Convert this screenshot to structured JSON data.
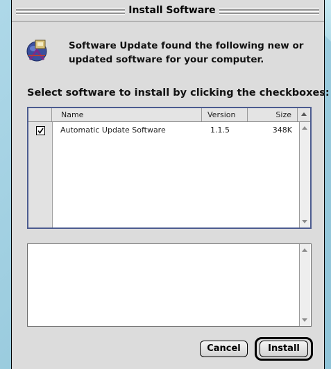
{
  "window": {
    "title": "Install Software"
  },
  "message": {
    "line1": "Software Update found the following new or",
    "line2": "updated software for your computer."
  },
  "instruction": "Select software to install by clicking the checkboxes:",
  "table": {
    "columns": {
      "name": "Name",
      "version": "Version",
      "size": "Size"
    },
    "rows": [
      {
        "checked": true,
        "name": "Automatic Update Software",
        "version": "1.1.5",
        "size": "348K"
      }
    ]
  },
  "buttons": {
    "cancel": "Cancel",
    "install": "Install"
  },
  "icons": {
    "app": "software-update-icon",
    "checkbox": "checkmark-icon",
    "scroll_up": "up-arrow-icon",
    "scroll_down": "down-arrow-icon",
    "sort": "sort-triangle-icon"
  },
  "colors": {
    "desktop": "#9ecfe0",
    "window": "#dcdcdc",
    "list_border": "#4b5b8f"
  }
}
